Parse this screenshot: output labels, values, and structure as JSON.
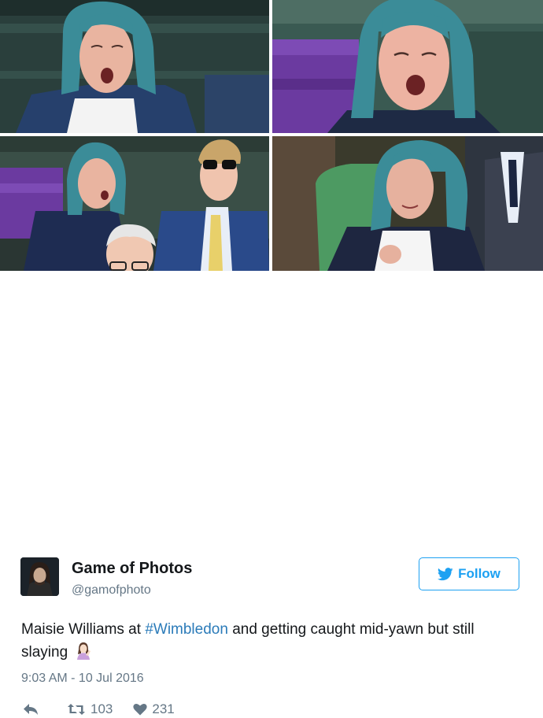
{
  "tweet": {
    "user": {
      "name": "Game of Photos",
      "handle": "@gamofphoto"
    },
    "follow_label": "Follow",
    "text_before": "Maisie Williams at ",
    "hashtag": "#Wimbledon",
    "text_after": " and getting caught mid-yawn but still slaying",
    "emoji": "woman-tipping-hand",
    "timestamp": "9:03 AM - 10 Jul 2016",
    "retweet_count": "103",
    "like_count": "231",
    "icons": {
      "follow": "twitter-bird-icon",
      "reply": "reply-icon",
      "retweet": "retweet-icon",
      "like": "heart-icon"
    }
  },
  "colors": {
    "accent": "#1da1f2",
    "hashtag": "#2b7bb9",
    "muted": "#657786",
    "hair": "#3b8c98"
  }
}
